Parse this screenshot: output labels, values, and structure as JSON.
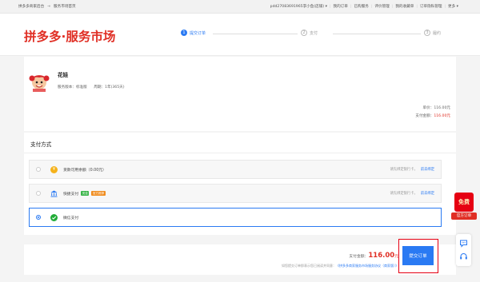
{
  "topbar": {
    "home_label": "拼多多商家后台",
    "market_home_label": "服务市场首页",
    "account_label": "pdd27083691965李小鱼(店铺)",
    "links": [
      "我的订单",
      "已购服务",
      "评价管理",
      "我的收藏单",
      "订单隐私管理",
      "更多"
    ]
  },
  "header": {
    "logo": "拼多多·服务市场",
    "steps": [
      {
        "num": "1",
        "label": "提交订单"
      },
      {
        "num": "2",
        "label": "支付"
      },
      {
        "num": "3",
        "label": "履约"
      }
    ]
  },
  "order": {
    "product_name": "花娃",
    "version_label": "服务版本：",
    "version_value": "标准版",
    "period_label": "周期：",
    "period_value": "1年(365天)",
    "unit_price_label": "单价：",
    "unit_price_value": "116.00元",
    "pay_amount_label": "支付金额：",
    "pay_amount_value": "116.00元"
  },
  "payment": {
    "title": "支付方式",
    "options": [
      {
        "label": "货款可用余额（0.00元）",
        "note": "请先绑定银行卡，",
        "link": "前去绑定",
        "icon": "coin-icon",
        "selected": false
      },
      {
        "label": "快捷支付",
        "tag1": "安全",
        "tag2": "官方推荐",
        "note": "请先绑定银行卡，",
        "link": "前去绑定",
        "icon": "bank-icon",
        "selected": false
      },
      {
        "label": "微信支付",
        "icon": "wechat-icon",
        "selected": true
      }
    ]
  },
  "bottom": {
    "total_label": "支付金额：",
    "total_amount": "116.00",
    "total_unit": "元",
    "agreement_prefix": "如您提交订单即表示您已阅读并同意：",
    "agreement_link": "《拼多多商家服务市场服务协议（商家版）》",
    "submit_label": "提交订单"
  },
  "side": {
    "promo_top": "免费",
    "promo_label": "官方订单"
  },
  "colors": {
    "brand_red": "#e02e24",
    "accent_blue": "#2a7af3",
    "highlight_red": "#e60012"
  }
}
